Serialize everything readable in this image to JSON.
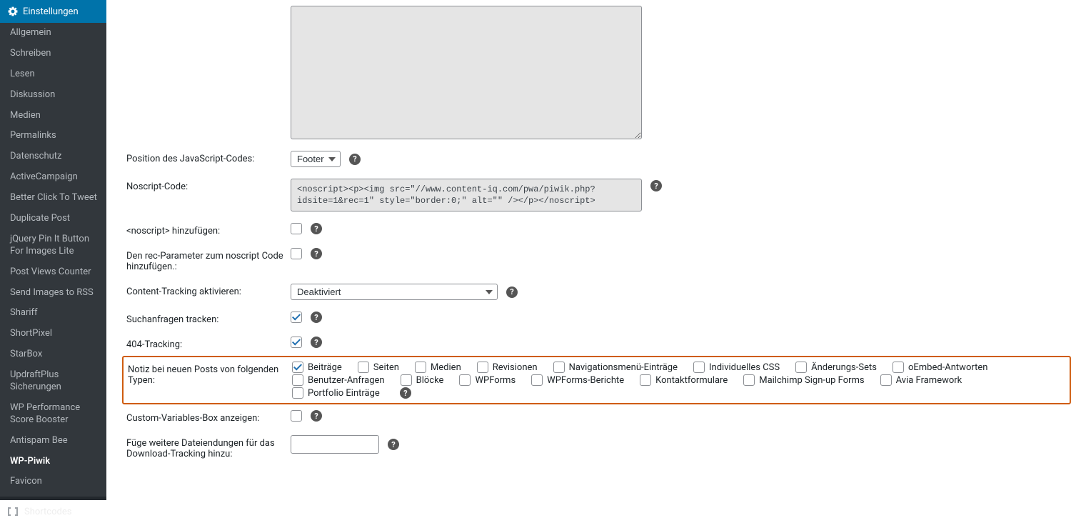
{
  "sidebar": {
    "header": "Einstellungen",
    "items": [
      "Allgemein",
      "Schreiben",
      "Lesen",
      "Diskussion",
      "Medien",
      "Permalinks",
      "Datenschutz",
      "ActiveCampaign",
      "Better Click To Tweet",
      "Duplicate Post",
      "jQuery Pin It Button For Images Lite",
      "Post Views Counter",
      "Send Images to RSS",
      "Shariff",
      "ShortPixel",
      "StarBox",
      "UpdraftPlus Sicherungen",
      "WP Performance Score Booster",
      "Antispam Bee",
      "WP-Piwik",
      "Favicon"
    ],
    "currentIndex": 19,
    "shortcodes": "Shortcodes"
  },
  "form": {
    "textarea_top": "",
    "position_label": "Position des JavaScript-Codes:",
    "position_value": "Footer",
    "position_options": [
      "Footer"
    ],
    "noscript_label": "Noscript-Code:",
    "noscript_value": "<noscript><p><img src=\"//www.content-iq.com/pwa/piwik.php?idsite=1&rec=1\" style=\"border:0;\" alt=\"\" /></p></noscript>",
    "add_noscript_label": "<noscript> hinzufügen:",
    "add_noscript_checked": false,
    "rec_param_label": "Den rec-Parameter zum noscript Code hinzufügen.:",
    "rec_param_checked": false,
    "content_tracking_label": "Content-Tracking aktivieren:",
    "content_tracking_value": "Deaktiviert",
    "content_tracking_options": [
      "Deaktiviert"
    ],
    "search_tracking_label": "Suchanfragen tracken:",
    "search_tracking_checked": true,
    "tracking404_label": "404-Tracking:",
    "tracking404_checked": true,
    "post_types_label": "Notiz bei neuen Posts von folgenden Typen:",
    "post_types": [
      {
        "label": "Beiträge",
        "checked": true
      },
      {
        "label": "Seiten",
        "checked": false
      },
      {
        "label": "Medien",
        "checked": false
      },
      {
        "label": "Revisionen",
        "checked": false
      },
      {
        "label": "Navigationsmenü-Einträge",
        "checked": false
      },
      {
        "label": "Individuelles CSS",
        "checked": false
      },
      {
        "label": "Änderungs-Sets",
        "checked": false
      },
      {
        "label": "oEmbed-Antworten",
        "checked": false
      },
      {
        "label": "Benutzer-Anfragen",
        "checked": false
      },
      {
        "label": "Blöcke",
        "checked": false
      },
      {
        "label": "WPForms",
        "checked": false
      },
      {
        "label": "WPForms-Berichte",
        "checked": false
      },
      {
        "label": "Kontaktformulare",
        "checked": false
      },
      {
        "label": "Mailchimp Sign-up Forms",
        "checked": false
      },
      {
        "label": "Avia Framework",
        "checked": false
      },
      {
        "label": "Portfolio Einträge",
        "checked": false
      }
    ],
    "custom_vars_label": "Custom-Variables-Box anzeigen:",
    "custom_vars_checked": false,
    "extensions_label": "Füge weitere Dateiendungen für das Download-Tracking hinzu:",
    "extensions_value": ""
  },
  "help_icon": "?"
}
